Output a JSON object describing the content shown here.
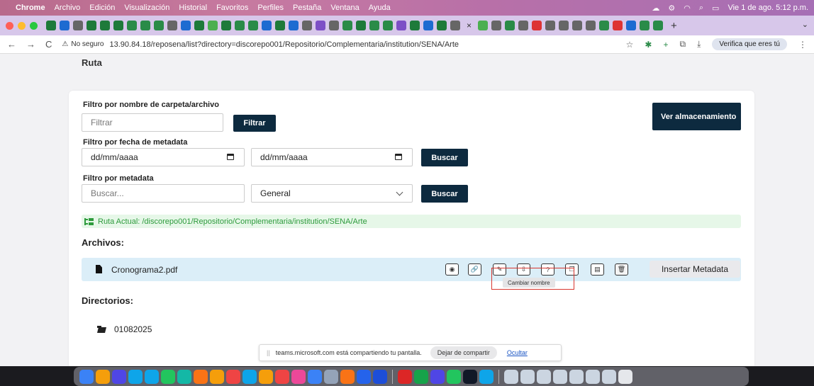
{
  "menubar": {
    "apple": "",
    "items": [
      "Chrome",
      "Archivo",
      "Edición",
      "Visualización",
      "Historial",
      "Favoritos",
      "Perfiles",
      "Pestaña",
      "Ventana",
      "Ayuda"
    ],
    "datetime": "Vie 1 de ago. 5:12 p.m."
  },
  "tabs": {
    "favicon_colors": [
      "#1e7a3a",
      "#1d6bd1",
      "#666",
      "#1e7a3a",
      "#1e7a3a",
      "#1e7a3a",
      "#2a8b48",
      "#2a8b48",
      "#2a8b48",
      "#666",
      "#1d6bd1",
      "#1e7a3a",
      "#4caf50",
      "#1e7a3a",
      "#2a8b48",
      "#2a8b48",
      "#1d6bd1",
      "#1e7a3a",
      "#1d6bd1",
      "#666",
      "#7d4fc6",
      "#666",
      "#2a8b48",
      "#1e7a3a",
      "#2a8b48",
      "#2a8b48",
      "#7d4fc6",
      "#1e7a3a",
      "#1d6bd1",
      "#1e7a3a",
      "#666"
    ],
    "close_glyph": "×",
    "favicon_colors_after": [
      "#4caf50",
      "#666",
      "#2a8b48",
      "#666",
      "#d33",
      "#666",
      "#666",
      "#666",
      "#666",
      "#2a8b48",
      "#d33",
      "#1d6bd1",
      "#2a8b48",
      "#2a8b48"
    ],
    "new_tab": "+",
    "menu": "⌄"
  },
  "toolbar": {
    "back": "←",
    "forward": "→",
    "reload": "C",
    "warning": "⚠",
    "not_secure": "No seguro",
    "url": "13.90.84.18/reposena/list?directory=discorepo001/Repositorio/Complementaria/institution/SENA/Arte",
    "verify": "Verifica que eres tú"
  },
  "page": {
    "ruta_heading": "Ruta",
    "storage_button": "Ver almacenamiento",
    "filter_name": {
      "label": "Filtro por nombre de carpeta/archivo",
      "placeholder": "Filtrar",
      "button": "Filtrar"
    },
    "filter_date": {
      "label": "Filtro por fecha de metadata",
      "from": "dd/mm/aaaa",
      "to": "dd/mm/aaaa",
      "button": "Buscar"
    },
    "filter_meta": {
      "label": "Filtro por metadata",
      "placeholder": "Buscar...",
      "select_value": "General",
      "button": "Buscar"
    },
    "current_path": "Ruta Actual:  /discorepo001/Repositorio/Complementaria/institution/SENA/Arte",
    "files_title": "Archivos:",
    "file": {
      "name": "Cronograma2.pdf",
      "insert_metadata": "Insertar Metadata",
      "tooltip": "Cambiar nombre"
    },
    "dirs_title": "Directorios:",
    "dir": {
      "name": "01082025"
    }
  },
  "sharebar": {
    "grip": "||",
    "message": "teams.microsoft.com está compartiendo tu pantalla.",
    "stop": "Dejar de compartir",
    "hide": "Ocultar"
  },
  "dock": {
    "icon_colors": [
      "#3b82f6",
      "#f59e0b",
      "#4f46e5",
      "#0ea5e9",
      "#0ea5e9",
      "#22c55e",
      "#14b8a6",
      "#f97316",
      "#f59e0b",
      "#ef4444",
      "#0ea5e9",
      "#f59e0b",
      "#ef4444",
      "#ec4899",
      "#3b82f6",
      "#94a3b8",
      "#f97316",
      "#2563eb",
      "#1d4ed8"
    ],
    "icon_colors_after": [
      "#dc2626",
      "#16a34a",
      "#4f46e5",
      "#22c55e",
      "#111827",
      "#0ea5e9"
    ],
    "icon_colors_end": [
      "#cbd5e1",
      "#cbd5e1",
      "#cbd5e1",
      "#cbd5e1",
      "#cbd5e1",
      "#cbd5e1",
      "#cbd5e1",
      "#e5e7eb"
    ]
  }
}
